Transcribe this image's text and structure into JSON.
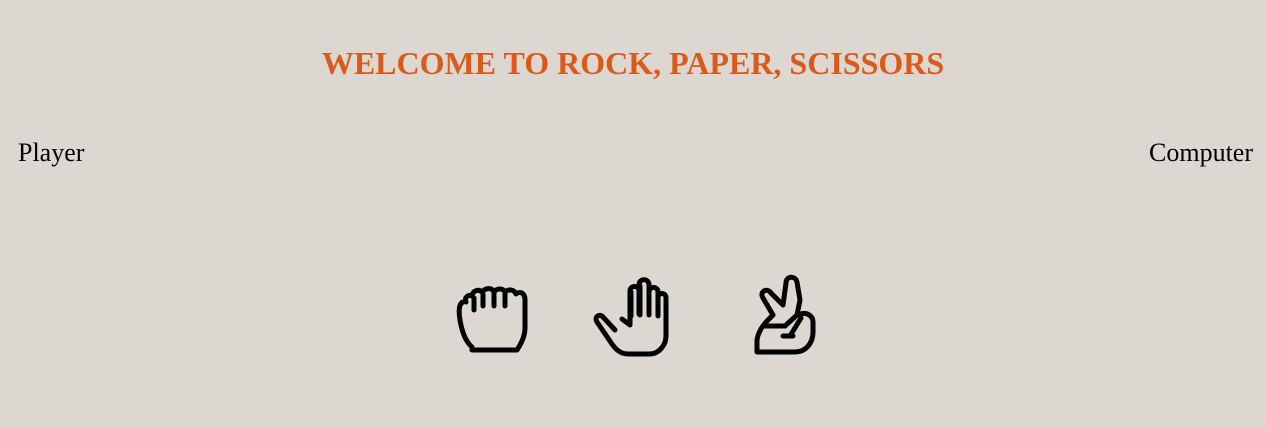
{
  "header": {
    "title": "WELCOME TO ROCK, PAPER, SCISSORS"
  },
  "scoreboard": {
    "player_label": "Player",
    "computer_label": "Computer"
  },
  "choices": [
    {
      "name": "rock",
      "icon": "fist-icon"
    },
    {
      "name": "paper",
      "icon": "open-hand-icon"
    },
    {
      "name": "scissors",
      "icon": "peace-sign-hand-icon"
    }
  ],
  "colors": {
    "background": "#dcd7d1",
    "title": "#d95a1a",
    "text": "#000000"
  }
}
